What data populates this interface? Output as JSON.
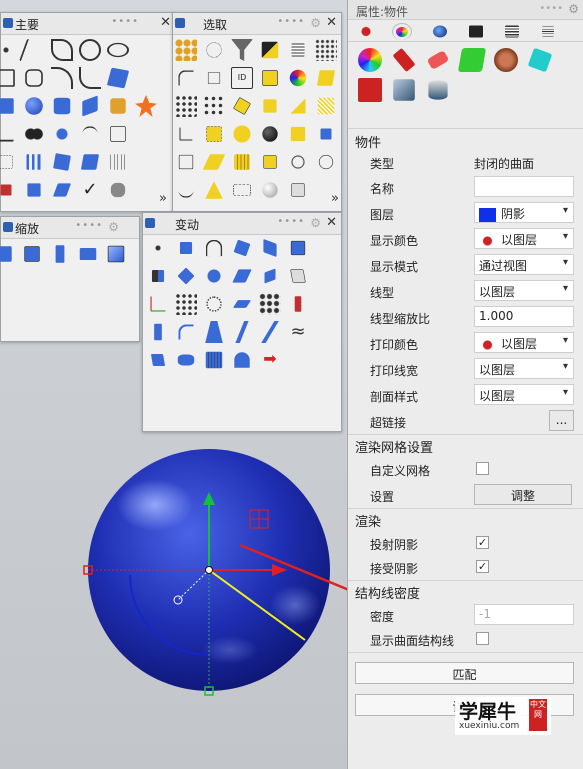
{
  "toolbars": {
    "main": {
      "title": "主要",
      "more": "»"
    },
    "select": {
      "title": "选取",
      "more": "»"
    },
    "zoom": {
      "title": "缩放"
    },
    "transform": {
      "title": "变动"
    }
  },
  "viewport": {
    "sphere_color": "#1f2fb4",
    "arrow_color": "#e02020"
  },
  "props": {
    "panel_title": "属性:物件",
    "section_object": "物件",
    "rows": {
      "type_label": "类型",
      "type_value": "封闭的曲面",
      "name_label": "名称",
      "name_value": "",
      "layer_label": "图层",
      "layer_value": "阴影",
      "layer_color": "#1030e8",
      "display_color_label": "显示颜色",
      "display_color_value": "以图层",
      "display_mode_label": "显示模式",
      "display_mode_value": "通过视图",
      "linetype_label": "线型",
      "linetype_value": "以图层",
      "linetype_scale_label": "线型缩放比",
      "linetype_scale_value": "1.000",
      "print_color_label": "打印颜色",
      "print_color_value": "以图层",
      "print_width_label": "打印线宽",
      "print_width_value": "以图层",
      "section_style_label": "剖面样式",
      "section_style_value": "以图层",
      "hyperlink_label": "超链接",
      "hyperlink_button": "..."
    },
    "section_mesh": "渲染网格设置",
    "mesh": {
      "custom_label": "自定义网格",
      "settings_label": "设置",
      "adjust_button": "调整"
    },
    "section_render": "渲染",
    "render": {
      "cast_label": "投射阴影",
      "cast_checked": "✓",
      "receive_label": "接受阴影",
      "receive_checked": "✓"
    },
    "section_isocurve": "结构线密度",
    "iso": {
      "density_label": "密度",
      "density_value": "-1",
      "show_label": "显示曲面结构线"
    },
    "match_button": "匹配",
    "details_button": "详情"
  },
  "watermark": {
    "brand": "学犀牛",
    "url": "xuexiniu.com",
    "seal": "中文网"
  }
}
